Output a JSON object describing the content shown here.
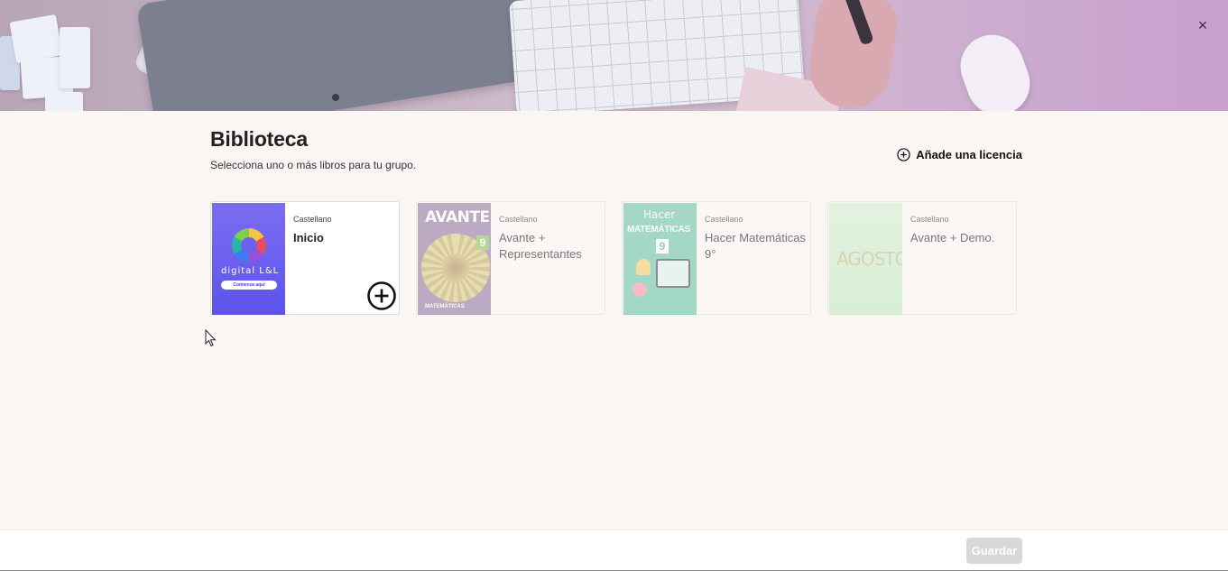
{
  "banner": {
    "close_glyph": "×"
  },
  "header": {
    "title": "Biblioteca",
    "subtitle": "Selecciona uno o más libros para tu grupo.",
    "add_license_label": "Añade una licencia"
  },
  "books": [
    {
      "language": "Castellano",
      "title": "Inicio",
      "state": "selectable",
      "cover_text": {
        "brand": "digital L&L",
        "button": "Comienza aquí"
      }
    },
    {
      "language": "Castellano",
      "title": "Avante + Representantes",
      "state": "disabled",
      "cover_text": {
        "title": "AVANTE",
        "grade": "9",
        "bottom": "MATEMÁTICAS"
      }
    },
    {
      "language": "Castellano",
      "title": "Hacer Matemáticas 9°",
      "state": "disabled",
      "cover_text": {
        "title": "Hacer",
        "subtitle": "MATEMÁTICAS",
        "grade": "9"
      }
    },
    {
      "language": "Castellano",
      "title": "Avante + Demo.",
      "state": "disabled",
      "cover_text": {
        "title": "AGOSTO"
      }
    }
  ],
  "footer": {
    "save_label": "Guardar",
    "save_enabled": false
  },
  "icons": {
    "close": "close-icon",
    "add_license": "plus-circle-icon",
    "add_book": "plus-circle-icon",
    "cursor": "mouse-pointer-icon"
  },
  "colors": {
    "background": "#faf6f3",
    "save_disabled": "#d8d8d8",
    "text_primary": "#222222"
  }
}
